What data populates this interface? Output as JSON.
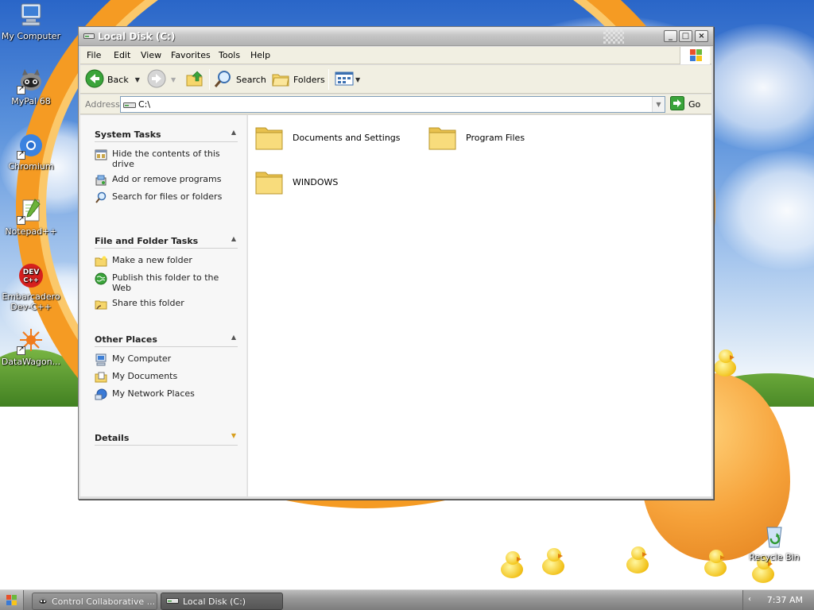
{
  "desktop": {
    "icons": [
      {
        "label": "My Computer"
      },
      {
        "label": "MyPal 68"
      },
      {
        "label": "Chromium"
      },
      {
        "label": "Notepad++"
      },
      {
        "label": "Embarcadero Dev-C++"
      },
      {
        "label": "DataWagon..."
      },
      {
        "label": "Recycle Bin"
      }
    ]
  },
  "window": {
    "title": "Local Disk (C:)",
    "buttons": {
      "minimize": "_",
      "maximize": "□",
      "close": "×"
    },
    "menu": [
      "File",
      "Edit",
      "View",
      "Favorites",
      "Tools",
      "Help"
    ],
    "toolbar": {
      "back": "Back",
      "search": "Search",
      "folders": "Folders"
    },
    "address": {
      "label": "Address",
      "value": "C:\\",
      "go": "Go"
    },
    "task_pane": {
      "system_tasks": {
        "title": "System Tasks",
        "items": [
          "Hide the contents of this drive",
          "Add or remove programs",
          "Search for files or folders"
        ]
      },
      "file_folder_tasks": {
        "title": "File and Folder Tasks",
        "items": [
          "Make a new folder",
          "Publish this folder to the Web",
          "Share this folder"
        ]
      },
      "other_places": {
        "title": "Other Places",
        "items": [
          "My Computer",
          "My Documents",
          "My Network Places"
        ]
      },
      "details": {
        "title": "Details"
      }
    },
    "folders": [
      "Documents and Settings",
      "Program Files",
      "WINDOWS"
    ]
  },
  "taskbar": {
    "tasks": [
      "Control Collaborative ...",
      "Local Disk (C:)"
    ],
    "clock": "7:37 AM"
  },
  "colors": {
    "folder": "#f6d66b",
    "link_text": "#222222",
    "task_active": "#5a5a5a"
  }
}
